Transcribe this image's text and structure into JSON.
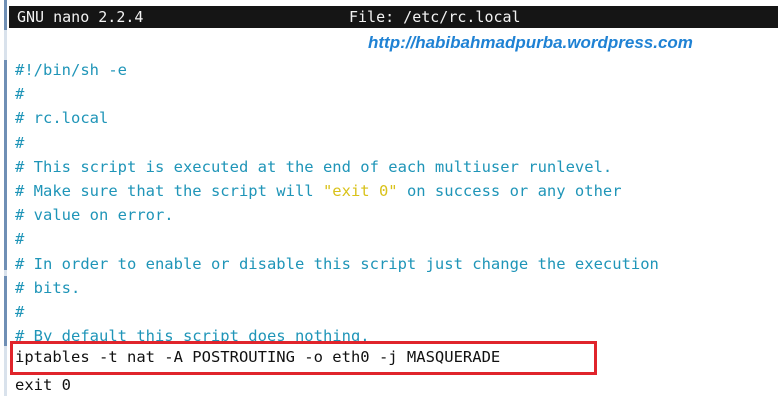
{
  "titlebar": {
    "version": "GNU nano 2.2.4",
    "file": "File: /etc/rc.local"
  },
  "watermark": "http://habibahmadpurba.wordpress.com",
  "lines": [
    {
      "text": "#!/bin/sh -e"
    },
    {
      "text": "#"
    },
    {
      "text": "# rc.local"
    },
    {
      "text": "#"
    },
    {
      "text": "# This script is executed at the end of each multiuser runlevel."
    },
    {
      "pre": "# Make sure that the script will ",
      "str": "\"exit 0\"",
      "post": " on success or any other"
    },
    {
      "text": "# value on error."
    },
    {
      "text": "#"
    },
    {
      "text": "# In order to enable or disable this script just change the execution"
    },
    {
      "text": "# bits."
    },
    {
      "text": "#"
    },
    {
      "text": "# By default this script does nothing."
    }
  ],
  "command": "iptables -t nat -A POSTROUTING -o eth0 -j MASQUERADE",
  "exit_line": "exit 0",
  "colors": {
    "comment": "#1f95b8",
    "string": "#d9c21a",
    "highlight_border": "#e0242b",
    "titlebar_bg": "#151515"
  }
}
